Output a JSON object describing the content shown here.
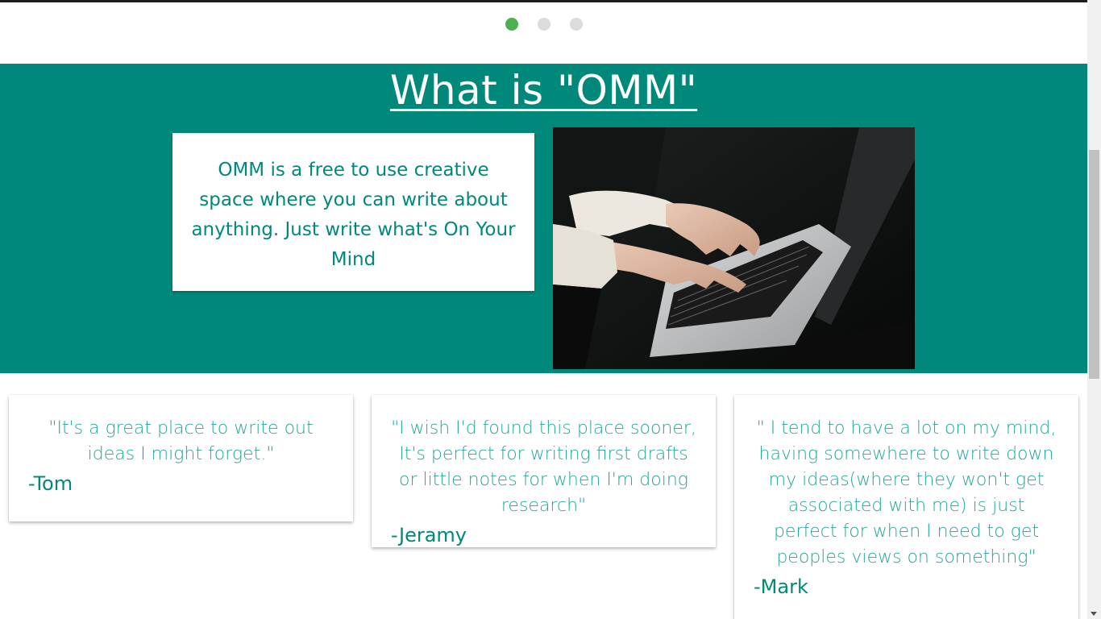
{
  "carousel": {
    "indicators": [
      {
        "active": true
      },
      {
        "active": false
      },
      {
        "active": false
      }
    ],
    "active_color": "#4caf50",
    "inactive_color": "#dcdcdc"
  },
  "about": {
    "title": "What is \"OMM\"",
    "description": "OMM is a free to use creative space where you can write about anything. Just write what's On Your Mind",
    "image": "laptop-typing-photo",
    "background_color": "#00897b"
  },
  "testimonials": [
    {
      "quote": "\"It's a great place to write out ideas I might forget.\"",
      "author": "-Tom"
    },
    {
      "quote": "\"I wish I'd found this place sooner, It's perfect for writing first drafts or little notes for when I'm doing research\"",
      "author": "-Jeramy"
    },
    {
      "quote": "\" I tend to have a lot on my mind, having somewhere to write down my ideas(where they won't get associated with me) is just perfect for when I need to get peoples views on something\"",
      "author": "-Mark"
    }
  ]
}
